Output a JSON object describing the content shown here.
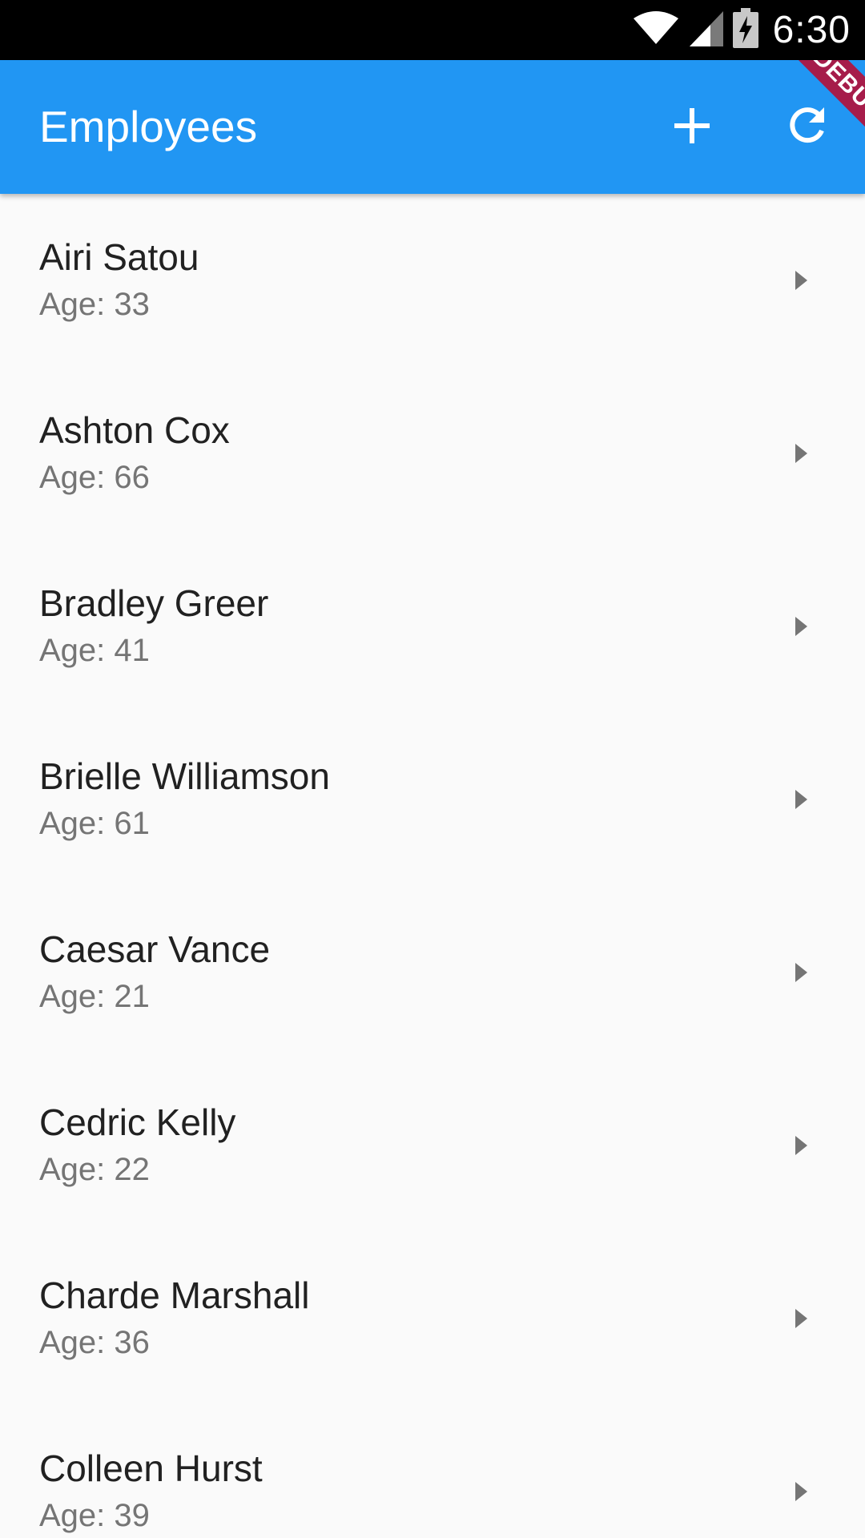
{
  "status_bar": {
    "time": "6:30",
    "icons": [
      "wifi-icon",
      "cellular-signal-icon",
      "battery-charging-icon"
    ]
  },
  "app_bar": {
    "title": "Employees",
    "actions": [
      "add-icon",
      "refresh-icon"
    ],
    "debug_banner": "DEBUG"
  },
  "colors": {
    "app_bar": "#2196f3",
    "status_bar": "#000000",
    "background": "#fafafa",
    "debug_banner": "#a61c4a",
    "name_text": "#212121",
    "age_text": "#757575",
    "chevron": "#757575"
  },
  "employees": [
    {
      "name": "Airi Satou",
      "age": "Age: 33"
    },
    {
      "name": "Ashton Cox",
      "age": "Age: 66"
    },
    {
      "name": "Bradley Greer",
      "age": "Age: 41"
    },
    {
      "name": "Brielle Williamson",
      "age": "Age: 61"
    },
    {
      "name": "Caesar Vance",
      "age": "Age: 21"
    },
    {
      "name": "Cedric Kelly",
      "age": "Age: 22"
    },
    {
      "name": "Charde Marshall",
      "age": "Age: 36"
    },
    {
      "name": "Colleen Hurst",
      "age": "Age: 39"
    }
  ]
}
